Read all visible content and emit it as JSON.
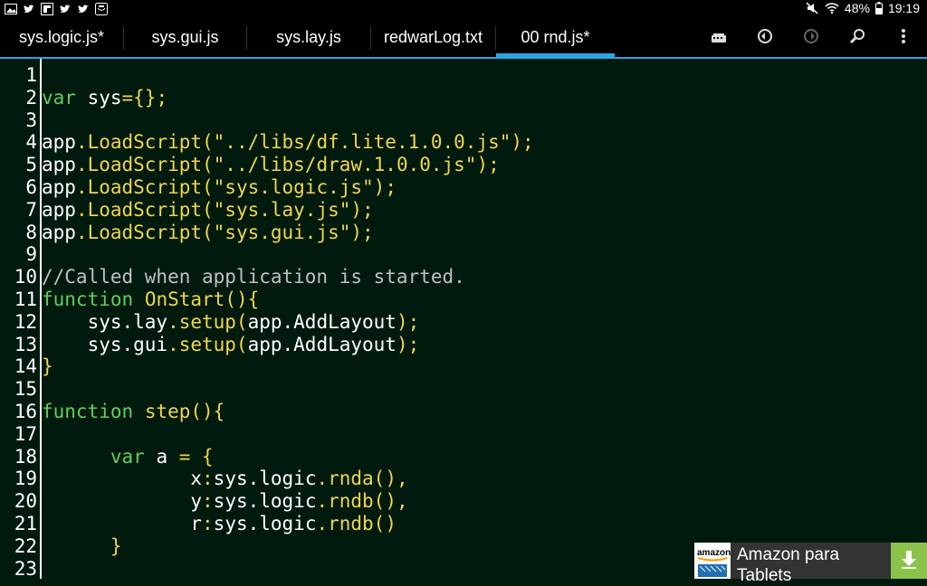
{
  "status_bar": {
    "battery": "48%",
    "time": "19:19",
    "left_icons": [
      "gallery-icon",
      "twitter-icon",
      "flipboard-icon",
      "twitter-icon",
      "twitter-icon",
      "shopping-icon"
    ],
    "right_icons": [
      "mute-icon",
      "wifi-icon",
      "battery-icon"
    ]
  },
  "tabs": [
    {
      "label": "sys.logic.js*"
    },
    {
      "label": "sys.gui.js"
    },
    {
      "label": "sys.lay.js"
    },
    {
      "label": "redwarLog.txt"
    },
    {
      "label": "00 rnd.js*"
    }
  ],
  "toolbar": [
    "keyboard-icon",
    "undo-icon",
    "redo-icon",
    "search-icon",
    "overflow-menu-icon"
  ],
  "code_lines": [
    [],
    [
      [
        "kw",
        "var"
      ],
      [
        "pl",
        " sys"
      ],
      [
        "fn",
        "={};"
      ]
    ],
    [],
    [
      [
        "pl",
        "app"
      ],
      [
        "fn",
        ".LoadScript("
      ],
      [
        "str",
        "\"../libs/df.lite.1.0.0.js\""
      ],
      [
        "fn",
        ");"
      ]
    ],
    [
      [
        "pl",
        "app"
      ],
      [
        "fn",
        ".LoadScript("
      ],
      [
        "str",
        "\"../libs/draw.1.0.0.js\""
      ],
      [
        "fn",
        ");"
      ]
    ],
    [
      [
        "pl",
        "app"
      ],
      [
        "fn",
        ".LoadScript("
      ],
      [
        "str",
        "\"sys.logic.js\""
      ],
      [
        "fn",
        ");"
      ]
    ],
    [
      [
        "pl",
        "app"
      ],
      [
        "fn",
        ".LoadScript("
      ],
      [
        "str",
        "\"sys.lay.js\""
      ],
      [
        "fn",
        ");"
      ]
    ],
    [
      [
        "pl",
        "app"
      ],
      [
        "fn",
        ".LoadScript("
      ],
      [
        "str",
        "\"sys.gui.js\""
      ],
      [
        "fn",
        ");"
      ]
    ],
    [],
    [
      [
        "cm",
        "//Called when application is started."
      ]
    ],
    [
      [
        "kw",
        "function"
      ],
      [
        "pl",
        " "
      ],
      [
        "fn",
        "OnStart(){"
      ]
    ],
    [
      [
        "pl",
        "    sys.lay"
      ],
      [
        "fn",
        ".setup("
      ],
      [
        "pl",
        "app.AddLayout"
      ],
      [
        "fn",
        ");"
      ]
    ],
    [
      [
        "pl",
        "    sys.gui"
      ],
      [
        "fn",
        ".setup("
      ],
      [
        "pl",
        "app.AddLayout"
      ],
      [
        "fn",
        ");"
      ]
    ],
    [
      [
        "fn",
        "}"
      ]
    ],
    [],
    [
      [
        "kw",
        "function"
      ],
      [
        "pl",
        " "
      ],
      [
        "fn",
        "step(){"
      ]
    ],
    [],
    [
      [
        "kw",
        "      var"
      ],
      [
        "pl",
        " a "
      ],
      [
        "fn",
        "= {"
      ]
    ],
    [
      [
        "pl",
        "             x"
      ],
      [
        "fn",
        ":"
      ],
      [
        "pl",
        "sys.logic"
      ],
      [
        "fn",
        ".rnda(),"
      ]
    ],
    [
      [
        "pl",
        "             y"
      ],
      [
        "fn",
        ":"
      ],
      [
        "pl",
        "sys.logic"
      ],
      [
        "fn",
        ".rndb(),"
      ]
    ],
    [
      [
        "pl",
        "             r"
      ],
      [
        "fn",
        ":"
      ],
      [
        "pl",
        "sys.logic"
      ],
      [
        "fn",
        ".rndb()"
      ]
    ],
    [
      [
        "fn",
        "      }"
      ]
    ],
    []
  ],
  "ad": {
    "brand": "amazon",
    "text_line1": "Amazon para",
    "text_line2": "Tablets",
    "download_icon": "download-icon"
  }
}
